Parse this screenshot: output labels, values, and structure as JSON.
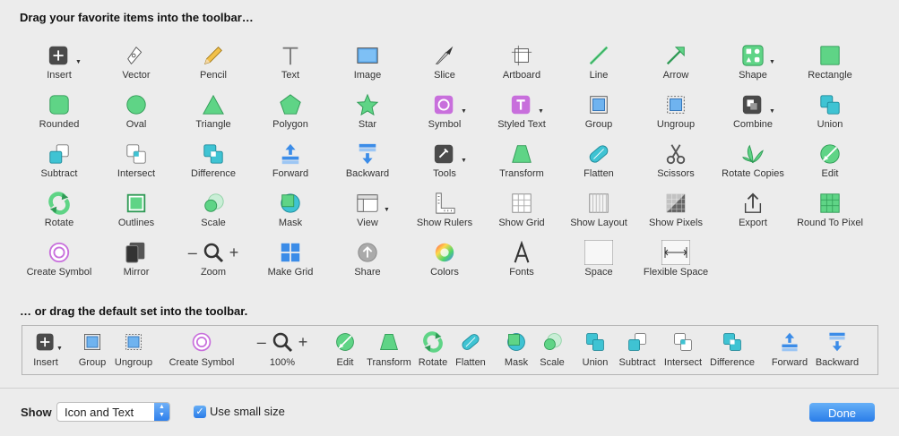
{
  "headings": {
    "favorites": "Drag your favorite items into the toolbar…",
    "default_set": "… or drag the default set into the toolbar."
  },
  "palette": [
    {
      "label": "Insert",
      "icon": "insert-icon"
    },
    {
      "label": "Vector",
      "icon": "vector-pen-icon"
    },
    {
      "label": "Pencil",
      "icon": "pencil-icon"
    },
    {
      "label": "Text",
      "icon": "text-icon"
    },
    {
      "label": "Image",
      "icon": "image-icon"
    },
    {
      "label": "Slice",
      "icon": "slice-knife-icon"
    },
    {
      "label": "Artboard",
      "icon": "artboard-icon"
    },
    {
      "label": "Line",
      "icon": "line-icon"
    },
    {
      "label": "Arrow",
      "icon": "arrow-icon"
    },
    {
      "label": "Shape",
      "icon": "shape-icon"
    },
    {
      "label": "Rectangle",
      "icon": "rectangle-icon"
    },
    {
      "label": "Rounded",
      "icon": "rounded-rect-icon"
    },
    {
      "label": "Oval",
      "icon": "oval-icon"
    },
    {
      "label": "Triangle",
      "icon": "triangle-icon"
    },
    {
      "label": "Polygon",
      "icon": "polygon-icon"
    },
    {
      "label": "Star",
      "icon": "star-icon"
    },
    {
      "label": "Symbol",
      "icon": "symbol-icon"
    },
    {
      "label": "Styled Text",
      "icon": "styled-text-icon"
    },
    {
      "label": "Group",
      "icon": "group-icon"
    },
    {
      "label": "Ungroup",
      "icon": "ungroup-icon"
    },
    {
      "label": "Combine",
      "icon": "combine-icon"
    },
    {
      "label": "Union",
      "icon": "union-icon"
    },
    {
      "label": "Subtract",
      "icon": "subtract-icon"
    },
    {
      "label": "Intersect",
      "icon": "intersect-icon"
    },
    {
      "label": "Difference",
      "icon": "difference-icon"
    },
    {
      "label": "Forward",
      "icon": "forward-icon"
    },
    {
      "label": "Backward",
      "icon": "backward-icon"
    },
    {
      "label": "Tools",
      "icon": "tools-icon"
    },
    {
      "label": "Transform",
      "icon": "transform-icon"
    },
    {
      "label": "Flatten",
      "icon": "flatten-icon"
    },
    {
      "label": "Scissors",
      "icon": "scissors-icon"
    },
    {
      "label": "Rotate Copies",
      "icon": "rotate-copies-icon"
    },
    {
      "label": "Edit",
      "icon": "edit-icon"
    },
    {
      "label": "Rotate",
      "icon": "rotate-icon"
    },
    {
      "label": "Outlines",
      "icon": "outlines-icon"
    },
    {
      "label": "Scale",
      "icon": "scale-icon"
    },
    {
      "label": "Mask",
      "icon": "mask-icon"
    },
    {
      "label": "View",
      "icon": "view-icon"
    },
    {
      "label": "Show Rulers",
      "icon": "rulers-icon"
    },
    {
      "label": "Show Grid",
      "icon": "grid-icon"
    },
    {
      "label": "Show Layout",
      "icon": "layout-icon"
    },
    {
      "label": "Show Pixels",
      "icon": "pixels-icon"
    },
    {
      "label": "Export",
      "icon": "export-icon"
    },
    {
      "label": "Round To Pixel",
      "icon": "round-to-pixel-icon"
    },
    {
      "label": "Create Symbol",
      "icon": "create-symbol-icon"
    },
    {
      "label": "Mirror",
      "icon": "mirror-icon"
    },
    {
      "label": "Zoom",
      "icon": "zoom-icon"
    },
    {
      "label": "Make Grid",
      "icon": "make-grid-icon"
    },
    {
      "label": "Share",
      "icon": "share-icon"
    },
    {
      "label": "Colors",
      "icon": "colors-icon"
    },
    {
      "label": "Fonts",
      "icon": "fonts-icon"
    },
    {
      "label": "Space",
      "icon": "space-icon"
    },
    {
      "label": "Flexible Space",
      "icon": "flexible-space-icon"
    }
  ],
  "default_set": [
    {
      "label": "Insert",
      "icon": "insert-icon"
    },
    {
      "label": "Group",
      "icon": "group-icon"
    },
    {
      "label": "Ungroup",
      "icon": "ungroup-icon"
    },
    {
      "label": "Create Symbol",
      "icon": "create-symbol-icon"
    },
    {
      "label": "100%",
      "icon": "zoom-icon"
    },
    {
      "label": "Edit",
      "icon": "edit-icon"
    },
    {
      "label": "Transform",
      "icon": "transform-icon"
    },
    {
      "label": "Rotate",
      "icon": "rotate-icon"
    },
    {
      "label": "Flatten",
      "icon": "flatten-icon"
    },
    {
      "label": "Mask",
      "icon": "mask-icon"
    },
    {
      "label": "Scale",
      "icon": "scale-icon"
    },
    {
      "label": "Union",
      "icon": "union-icon"
    },
    {
      "label": "Subtract",
      "icon": "subtract-icon"
    },
    {
      "label": "Intersect",
      "icon": "intersect-icon"
    },
    {
      "label": "Difference",
      "icon": "difference-icon"
    },
    {
      "label": "Forward",
      "icon": "forward-icon"
    },
    {
      "label": "Backward",
      "icon": "backward-icon"
    }
  ],
  "footer": {
    "show_label": "Show",
    "show_value": "Icon and Text",
    "small_size_label": "Use small size",
    "small_size_checked": true,
    "done_label": "Done"
  },
  "colors": {
    "green": "#5fd486",
    "green_dark": "#2f9a55",
    "teal": "#3fc3d3",
    "blue": "#2d7fe8",
    "purple": "#c86fdc"
  }
}
